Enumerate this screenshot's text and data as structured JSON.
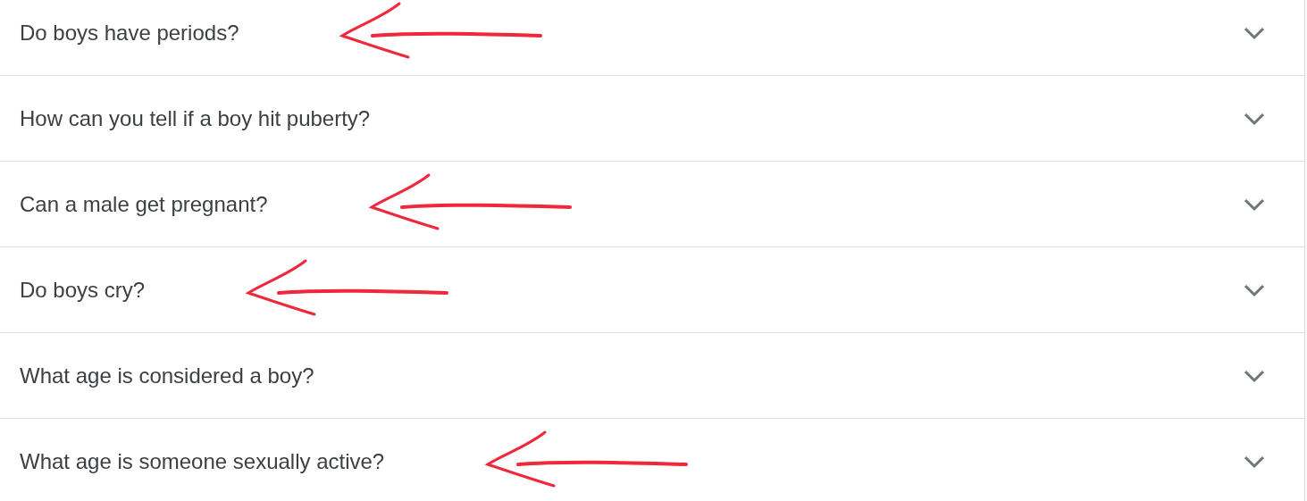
{
  "questions": [
    {
      "text": "Do boys have periods?",
      "expanded": false,
      "annotated": true
    },
    {
      "text": "How can you tell if a boy hit puberty?",
      "expanded": false,
      "annotated": false
    },
    {
      "text": "Can a male get pregnant?",
      "expanded": false,
      "annotated": true
    },
    {
      "text": "Do boys cry?",
      "expanded": false,
      "annotated": true
    },
    {
      "text": "What age is considered a boy?",
      "expanded": false,
      "annotated": false
    },
    {
      "text": "What age is someone sexually active?",
      "expanded": false,
      "annotated": true
    }
  ]
}
